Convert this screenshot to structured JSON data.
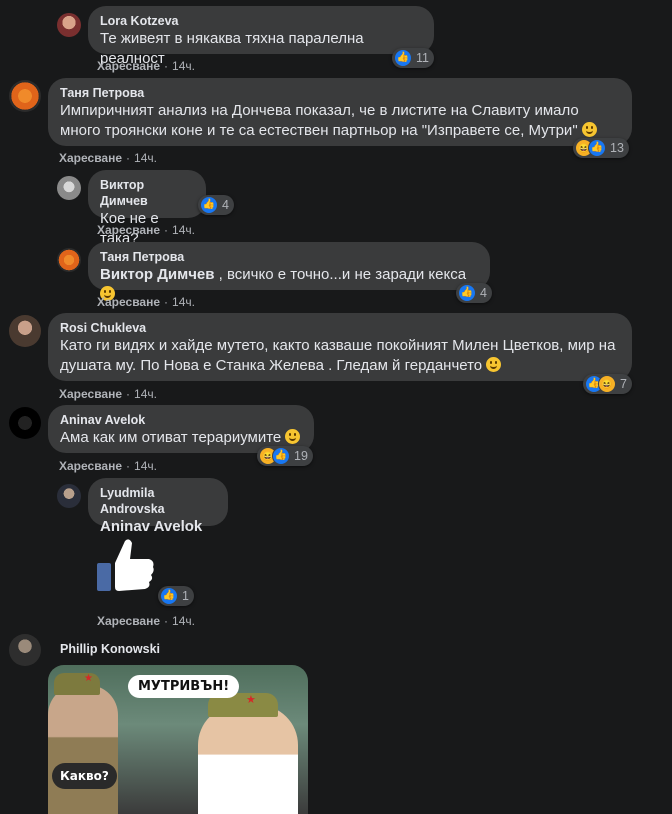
{
  "comments": [
    {
      "name": "Lora Kotzeva",
      "text": "Те живеят в някаква тяхна паралелна реалност",
      "like": "Харесване",
      "time": "14ч.",
      "reactions": "11"
    },
    {
      "name": "Таня Петрова",
      "text": "Импиричният анализ на Дончева показал, че в листите на Славиту имало много троянски коне и те са естествен партньор на \"Изправете се, Мутри\"",
      "like": "Харесване",
      "time": "14ч.",
      "reactions": "13"
    },
    {
      "name": "Виктор Димчев",
      "text": "Кое не е така?",
      "like": "Харесване",
      "time": "14ч.",
      "reactions": "4"
    },
    {
      "name": "Таня Петрова",
      "mention": "Виктор Димчев",
      "text": ", всичко е точно...и не заради кекса",
      "like": "Харесване",
      "time": "14ч.",
      "reactions": "4"
    },
    {
      "name": "Rosi Chukleva",
      "text": "Като ги видях и хайде мутето, както казваше покойният Милен Цветков, мир на душата му. По Нова е Станка Желева . Гледам й герданчето",
      "like": "Харесване",
      "time": "14ч.",
      "reactions": "7"
    },
    {
      "name": "Aninav Avelok",
      "text": "Ама как им отиват терариумите",
      "like": "Харесване",
      "time": "14ч.",
      "reactions": "19"
    },
    {
      "name": "Lyudmila Androvska",
      "mention": "Aninav Avelok",
      "like": "Харесване",
      "time": "14ч.",
      "reactions": "1"
    },
    {
      "name": "Phillip Konowski",
      "meme_top": "МУТРИВЪН!",
      "meme_bottom": "Какво?"
    }
  ],
  "colors": {
    "bg": "#18191a",
    "bubble": "#3a3b3c",
    "like": "#1877f2",
    "haha": "#f7b125"
  }
}
